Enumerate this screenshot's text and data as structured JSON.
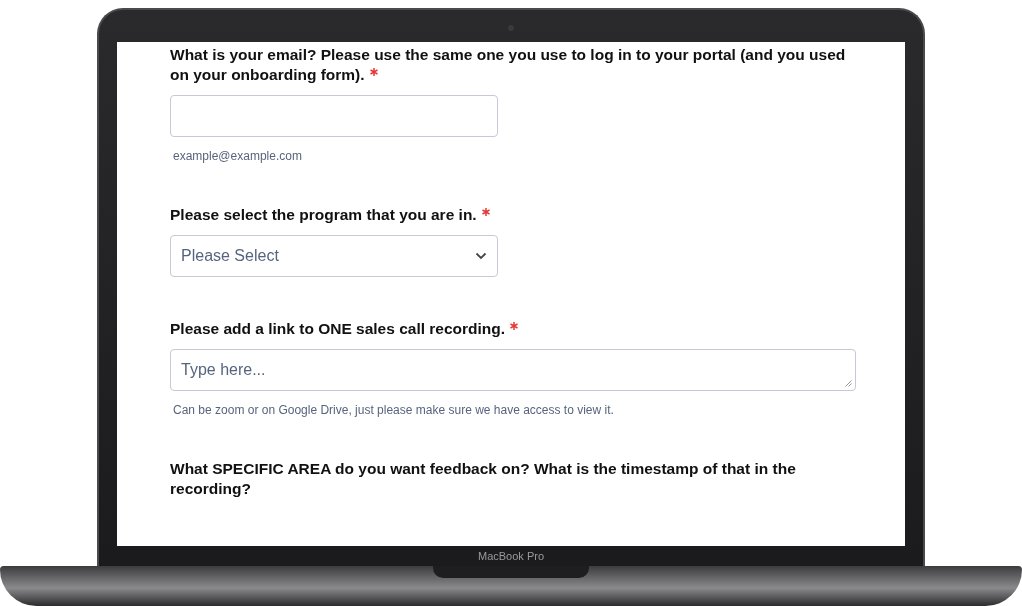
{
  "device": {
    "label": "MacBook Pro"
  },
  "questions": [
    {
      "label": "What is your email? Please use the same one you use to log in to your portal (and you used on your onboarding form).",
      "required": true,
      "field": {
        "kind": "input"
      },
      "hint": "example@example.com"
    },
    {
      "label": "Please select the program that you are in.",
      "required": true,
      "field": {
        "kind": "select",
        "placeholder": "Please Select"
      }
    },
    {
      "label": "Please add a link to ONE sales call recording.",
      "required": true,
      "field": {
        "kind": "textarea",
        "placeholder": "Type here..."
      },
      "hint": "Can be zoom or on Google Drive, just please make sure we have access to view it."
    },
    {
      "label": "What SPECIFIC AREA do you want feedback on? What is the timestamp of that in the recording?",
      "required": false
    }
  ]
}
